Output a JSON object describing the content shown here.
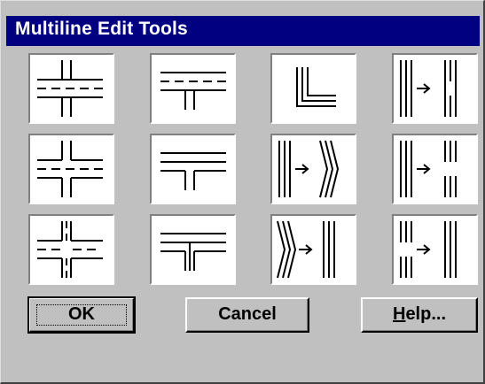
{
  "dialog": {
    "title": "Multiline Edit Tools",
    "colors": {
      "titlebar": "#000080",
      "face": "#c0c0c0"
    }
  },
  "tools": [
    {
      "icon": "closed-cross-icon"
    },
    {
      "icon": "closed-tee-icon"
    },
    {
      "icon": "corner-joint-icon"
    },
    {
      "icon": "cut-single-icon"
    },
    {
      "icon": "open-cross-icon"
    },
    {
      "icon": "open-tee-icon"
    },
    {
      "icon": "add-vertex-icon"
    },
    {
      "icon": "cut-all-icon"
    },
    {
      "icon": "merged-cross-icon"
    },
    {
      "icon": "merged-tee-icon"
    },
    {
      "icon": "delete-vertex-icon"
    },
    {
      "icon": "weld-all-icon"
    }
  ],
  "buttons": {
    "ok": "OK",
    "cancel": "Cancel",
    "help_mnemonic": "H",
    "help_rest": "elp..."
  }
}
